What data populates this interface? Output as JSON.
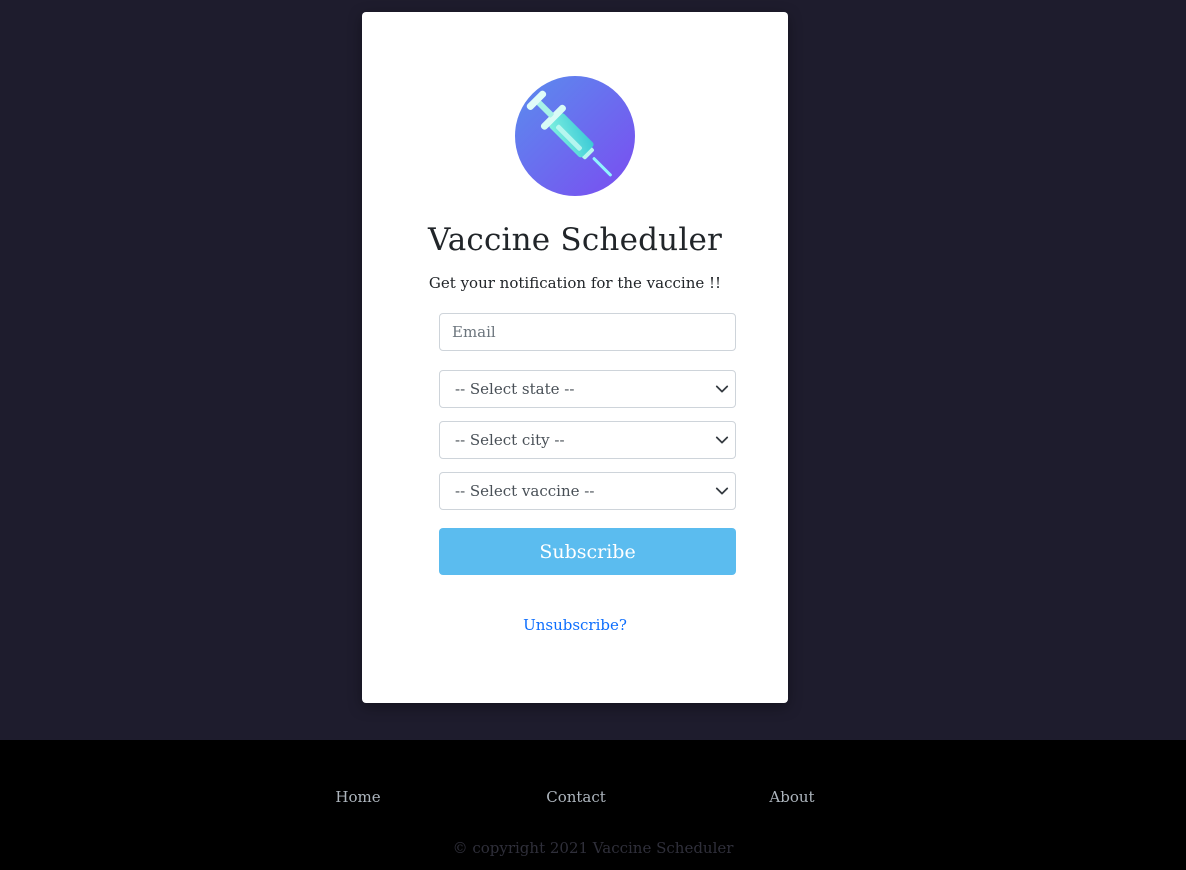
{
  "app": {
    "title": "Vaccine Scheduler",
    "subtitle": "Get your notification for the vaccine !!",
    "logo_icon": "syringe-icon"
  },
  "form": {
    "email_placeholder": "Email",
    "state_placeholder": "-- Select state --",
    "city_placeholder": "-- Select city --",
    "vaccine_placeholder": "-- Select vaccine --",
    "subscribe_label": "Subscribe",
    "unsubscribe_label": "Unsubscribe?"
  },
  "footer": {
    "nav": [
      {
        "label": "Home"
      },
      {
        "label": "Contact"
      },
      {
        "label": "About"
      }
    ],
    "copyright": "© copyright 2021 Vaccine Scheduler"
  },
  "colors": {
    "page_background": "#1e1c2d",
    "card_background": "#ffffff",
    "button": "#5bbcef",
    "link": "#0d6efd",
    "footer_background": "#000000"
  }
}
